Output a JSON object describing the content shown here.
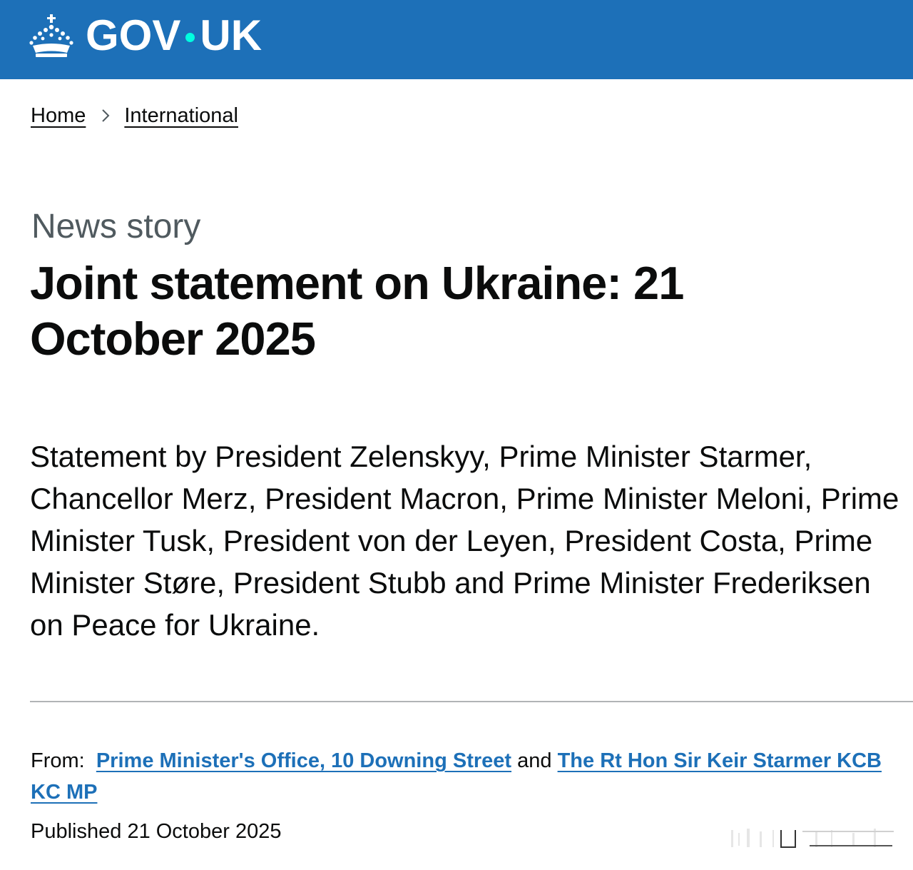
{
  "header": {
    "logo_text_left": "GOV",
    "logo_text_right": "UK",
    "logo_icon": "crown-icon",
    "background_color": "#1d70b8",
    "dot_color": "#00ffe0"
  },
  "breadcrumb": {
    "items": [
      {
        "label": "Home"
      },
      {
        "label": "International"
      }
    ],
    "separator_icon": "chevron-right-icon"
  },
  "article": {
    "caption": "News story",
    "title": "Joint statement on Ukraine: 21 October 2025",
    "lead": "Statement by President Zelenskyy, Prime Minister Starmer, Chancellor Merz, President Macron, Prime Minister Meloni, Prime Minister Tusk,  President von der Leyen, President Costa, Prime Minister Støre, President Stubb and Prime Minister Frederiksen on Peace for Ukraine."
  },
  "metadata": {
    "from_label": "From:",
    "organisations": [
      "Prime Minister's Office, 10 Downing Street",
      "The Rt Hon Sir Keir Starmer KCB KC MP"
    ],
    "and_text": "and",
    "published_label": "Published",
    "published_date": "21 October 2025",
    "link_color": "#1d70b8"
  }
}
